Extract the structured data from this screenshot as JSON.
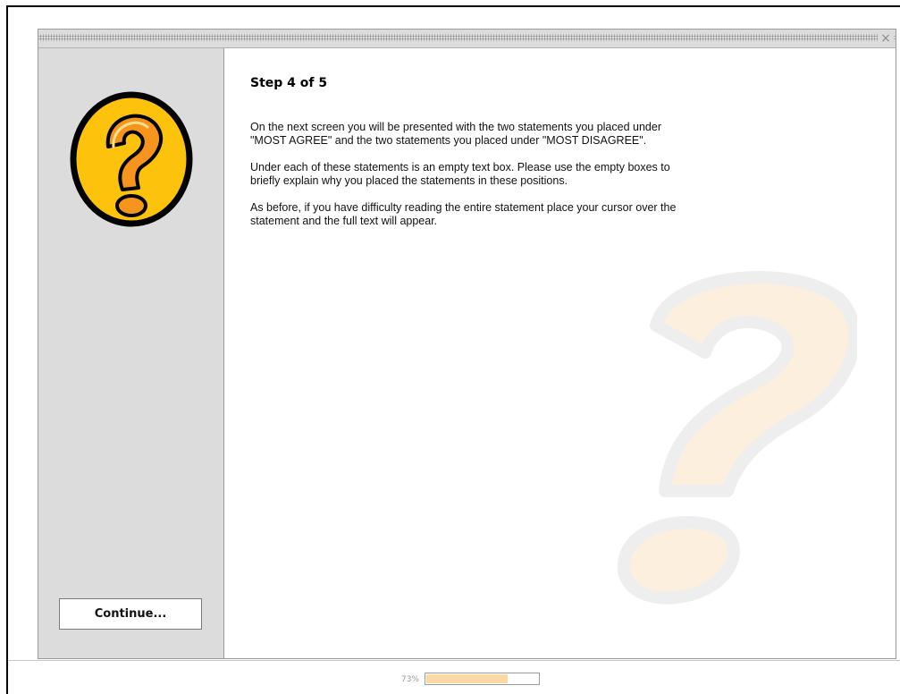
{
  "dialog": {
    "close_glyph": "×"
  },
  "sidebar": {
    "icon": "question-mark-icon",
    "continue_label": "Continue..."
  },
  "main": {
    "step_title": "Step 4 of 5",
    "paragraphs": [
      "On the next screen you will be presented with the two statements you placed under \"MOST AGREE\" and the two statements you placed under \"MOST DISAGREE\".",
      "Under each of these statements is an empty text box. Please use the empty boxes to briefly explain why you placed the statements in these positions.",
      "As before, if you have difficulty reading the entire statement place your cursor over the statement and the full text will appear."
    ],
    "watermark_icon": "question-mark-watermark-icon"
  },
  "progress": {
    "label": "73%",
    "fill_fraction": 0.73
  },
  "colors": {
    "icon_yellow": "#fcc20c",
    "icon_orange": "#f7941d",
    "sidebar_gray": "#dcdcdc",
    "progress_fill": "#fbd9a4"
  }
}
